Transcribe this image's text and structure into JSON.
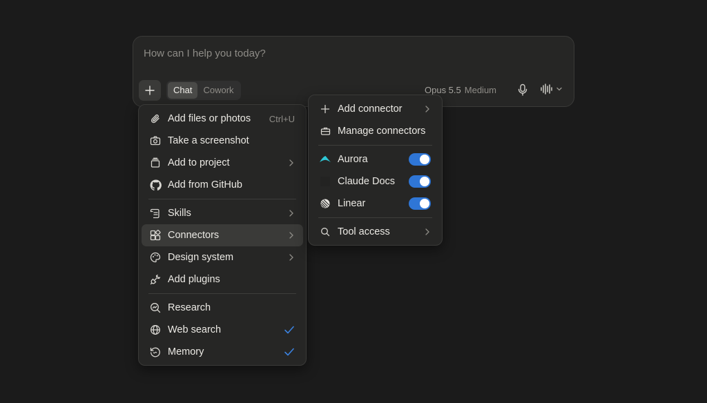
{
  "composer": {
    "placeholder": "How can I help you today?",
    "modes": [
      "Chat",
      "Cowork"
    ],
    "active_mode": "Chat",
    "model": "Opus 5.5",
    "effort": "Medium"
  },
  "attach_menu": {
    "items": [
      {
        "label": "Add files or photos",
        "shortcut": "Ctrl+U",
        "icon": "paperclip-icon"
      },
      {
        "label": "Take a screenshot",
        "icon": "camera-icon"
      },
      {
        "label": "Add to project",
        "icon": "project-icon",
        "submenu": true
      },
      {
        "label": "Add from GitHub",
        "icon": "github-icon"
      },
      {
        "label": "Skills",
        "icon": "skills-icon",
        "submenu": true
      },
      {
        "label": "Connectors",
        "icon": "connectors-icon",
        "submenu": true,
        "highlighted": true
      },
      {
        "label": "Design system",
        "icon": "palette-icon",
        "submenu": true
      },
      {
        "label": "Add plugins",
        "icon": "plug-icon"
      },
      {
        "label": "Research",
        "icon": "research-icon"
      },
      {
        "label": "Web search",
        "icon": "globe-icon",
        "checked": true
      },
      {
        "label": "Memory",
        "icon": "memory-icon",
        "checked": true
      }
    ]
  },
  "connectors_menu": {
    "add_connector": "Add connector",
    "manage_connectors": "Manage connectors",
    "connectors": [
      {
        "label": "Aurora",
        "enabled": true,
        "icon": "aurora-icon"
      },
      {
        "label": "Claude Docs",
        "enabled": true,
        "icon": "claude-docs-icon"
      },
      {
        "label": "Linear",
        "enabled": true,
        "icon": "linear-icon"
      }
    ],
    "tool_access": "Tool access"
  },
  "colors": {
    "background": "#1b1b1b",
    "panel": "#262625",
    "accent_blue": "#2f76d6",
    "check_blue": "#3b82e0",
    "aurora_cyan": "#2ec7d6"
  }
}
